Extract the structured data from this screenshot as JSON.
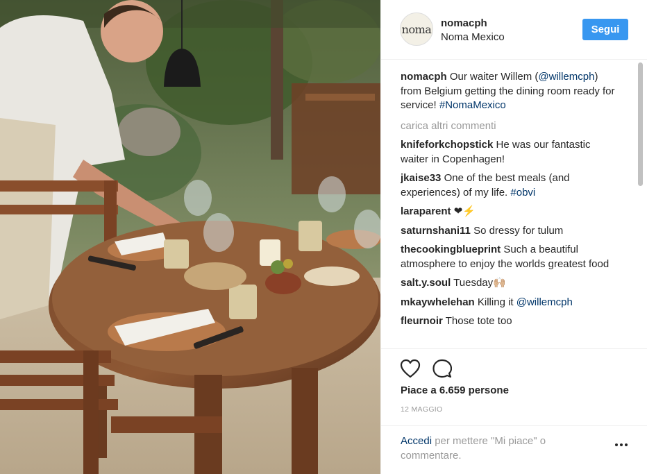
{
  "post": {
    "username": "nomacph",
    "location": "Noma Mexico",
    "avatar_text": "noma",
    "follow_label": "Segui"
  },
  "caption": {
    "username": "nomacph",
    "text_before_mention": "Our waiter Willem (",
    "mention": "@willemcph",
    "text_after_mention": ") from Belgium getting the dining room ready for service!",
    "hashtag": "#NomaMexico"
  },
  "load_more_label": "carica altri commenti",
  "comments": [
    {
      "username": "knifeforkchopstick",
      "text": "He was our fantastic waiter in Copenhagen!",
      "link": ""
    },
    {
      "username": "jkaise33",
      "text": "One of the best meals (and experiences) of my life.",
      "link": "#obvi"
    },
    {
      "username": "laraparent",
      "text": "❤⚡",
      "link": ""
    },
    {
      "username": "saturnshani11",
      "text": "So dressy for tulum",
      "link": ""
    },
    {
      "username": "thecookingblueprint",
      "text": "Such a beautiful atmosphere to enjoy the worlds greatest food",
      "link": ""
    },
    {
      "username": "salt.y.soul",
      "text": "Tuesday🙌🏼",
      "link": ""
    },
    {
      "username": "mkaywhelehan",
      "text": "Killing it",
      "link": "@willemcph"
    },
    {
      "username": "fleurnoir",
      "text": "Those tote too",
      "link": ""
    }
  ],
  "actions": {
    "heart_icon": "heart-icon",
    "comment_icon": "comment-icon",
    "likes_text": "Piace a 6.659 persone",
    "date": "12 MAGGIO"
  },
  "login": {
    "link_label": "Accedi",
    "rest_text": "per mettere \"Mi piace\" o commentare."
  },
  "colors": {
    "follow_button": "#3897f0",
    "link": "#003569",
    "muted": "#999999"
  }
}
